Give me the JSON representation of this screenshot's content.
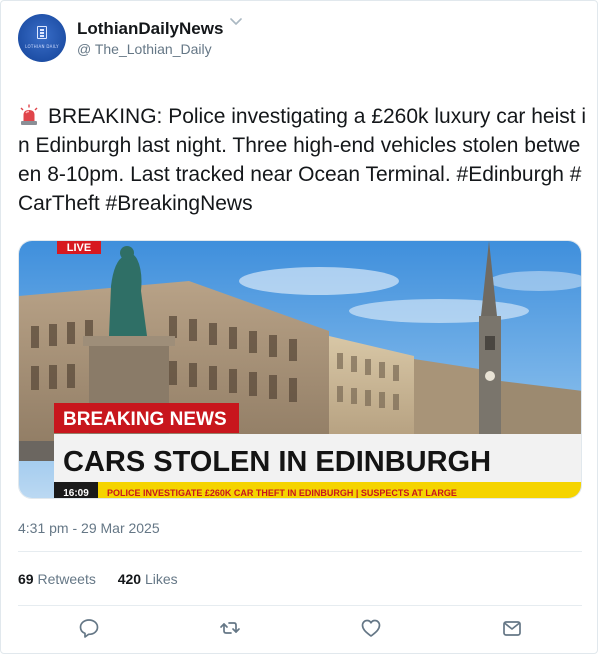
{
  "author": {
    "name": "LothianDailyNews",
    "handle": "@ The_Lothian_Daily",
    "avatar_tag": "LOTHIAN DAILY",
    "avatar_icon": "newspaper-logo"
  },
  "tweet": {
    "emoji": "police-car-light",
    "text": "BREAKING: Police investigating a £260k luxury car heist in Edinburgh last night. Three high-end vehicles stolen between 8-10pm. Last tracked near Ocean Terminal. #Edinburgh #CarTheft #BreakingNews"
  },
  "media": {
    "live_label": "LIVE",
    "breaking_label": "BREAKING NEWS",
    "headline": "CARS STOLEN IN EDINBURGH",
    "ticker_time": "16:09",
    "ticker_text": "POLICE INVESTIGATE £260K CAR THEFT IN EDINBURGH | SUSPECTS AT LARGE"
  },
  "timestamp": "4:31 pm - 29 Mar 2025",
  "stats": {
    "retweets_count": "69",
    "retweets_label": "Retweets",
    "likes_count": "420",
    "likes_label": "Likes"
  },
  "actions": [
    "reply-icon",
    "retweet-icon",
    "like-icon",
    "message-icon"
  ],
  "colors": {
    "text": "#14171a",
    "secondary": "#657786",
    "breaking_red": "#d71920",
    "ticker_yellow": "#f5d400",
    "avatar_blue": "#2a5db8"
  }
}
